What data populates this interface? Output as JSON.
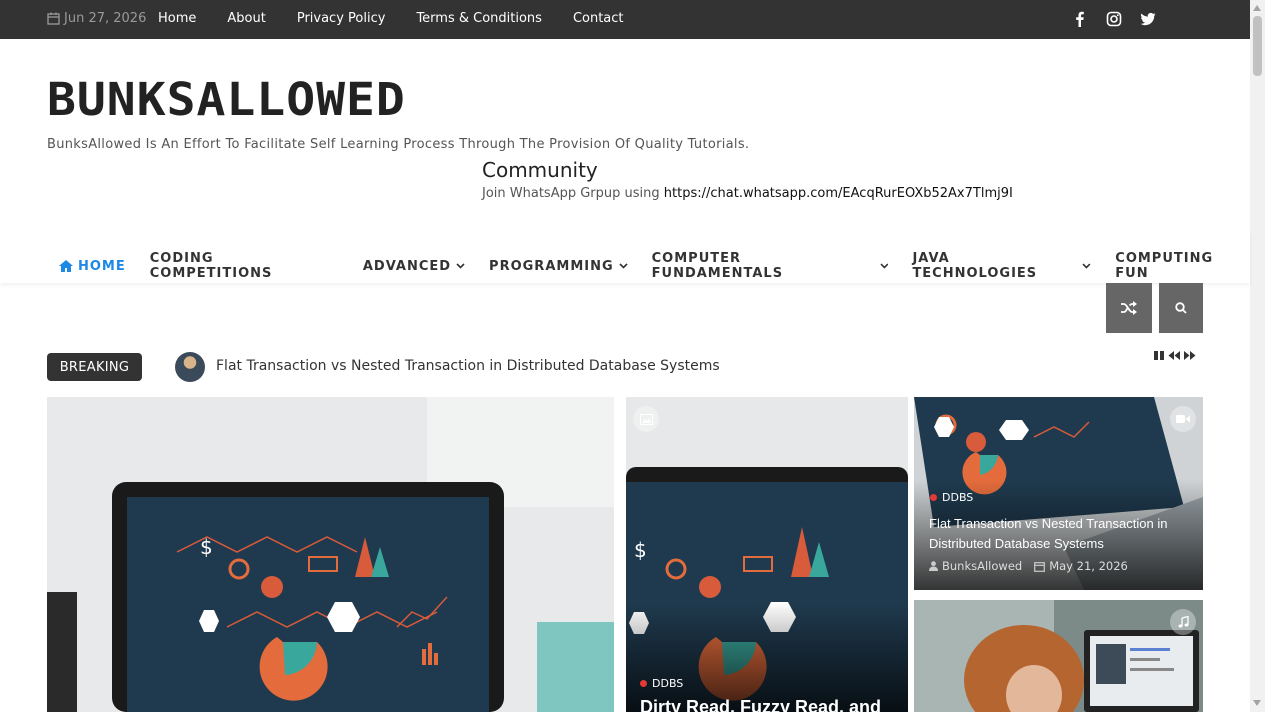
{
  "topbar": {
    "date": "Jun 27, 2026",
    "nav": [
      "Home",
      "About",
      "Privacy Policy",
      "Terms & Conditions",
      "Contact"
    ],
    "social": [
      "facebook-icon",
      "instagram-icon",
      "twitter-icon"
    ]
  },
  "header": {
    "logo": "BUNKSALLOWED",
    "tagline": "BunksAllowed Is An Effort To Facilitate Self Learning Process Through The Provision Of Quality Tutorials.",
    "community_title": "Community",
    "whatsapp_prefix": "Join WhatsApp Grpup using",
    "whatsapp_link": "https://chat.whatsapp.com/EAcqRurEOXb52Ax7Tlmj9I"
  },
  "mainnav": {
    "items": [
      {
        "label": "HOME",
        "active": true,
        "dropdown": false
      },
      {
        "label": "CODING COMPETITIONS",
        "active": false,
        "dropdown": false
      },
      {
        "label": "ADVANCED",
        "active": false,
        "dropdown": true
      },
      {
        "label": "PROGRAMMING",
        "active": false,
        "dropdown": true
      },
      {
        "label": "COMPUTER FUNDAMENTALS",
        "active": false,
        "dropdown": true
      },
      {
        "label": "JAVA TECHNOLOGIES",
        "active": false,
        "dropdown": true
      },
      {
        "label": "COMPUTING FUN",
        "active": false,
        "dropdown": false
      }
    ],
    "accent": "#1e88e5"
  },
  "breaking": {
    "label": "BREAKING",
    "headline": "Flat Transaction vs Nested Transaction in Distributed Database Systems"
  },
  "cards": {
    "middle": {
      "category": "DDBS",
      "title": "Dirty Read, Fuzzy Read, and"
    },
    "right_top": {
      "category": "DDBS",
      "title": "Flat Transaction vs Nested Transaction in Distributed Database Systems",
      "author": "BunksAllowed",
      "date": "May 21, 2026"
    }
  }
}
